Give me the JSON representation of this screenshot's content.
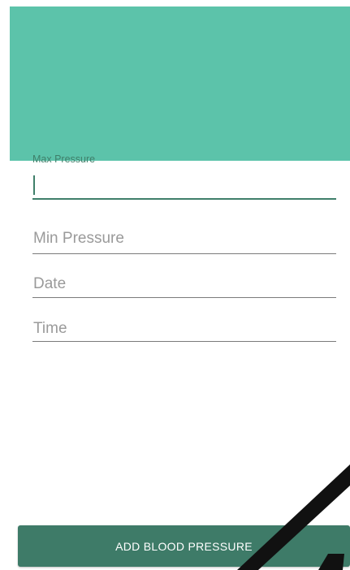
{
  "colors": {
    "banner": "#5cc3aa",
    "accent": "#3e7b68",
    "hint_text": "#9a9a9a",
    "underline": "#7b7b7b"
  },
  "form": {
    "max_pressure": {
      "label": "Max Pressure",
      "value": ""
    },
    "min_pressure": {
      "placeholder": "Min Pressure",
      "value": ""
    },
    "date": {
      "placeholder": "Date",
      "value": ""
    },
    "time": {
      "placeholder": "Time",
      "value": ""
    }
  },
  "actions": {
    "submit_label": "ADD BLOOD PRESSURE"
  }
}
